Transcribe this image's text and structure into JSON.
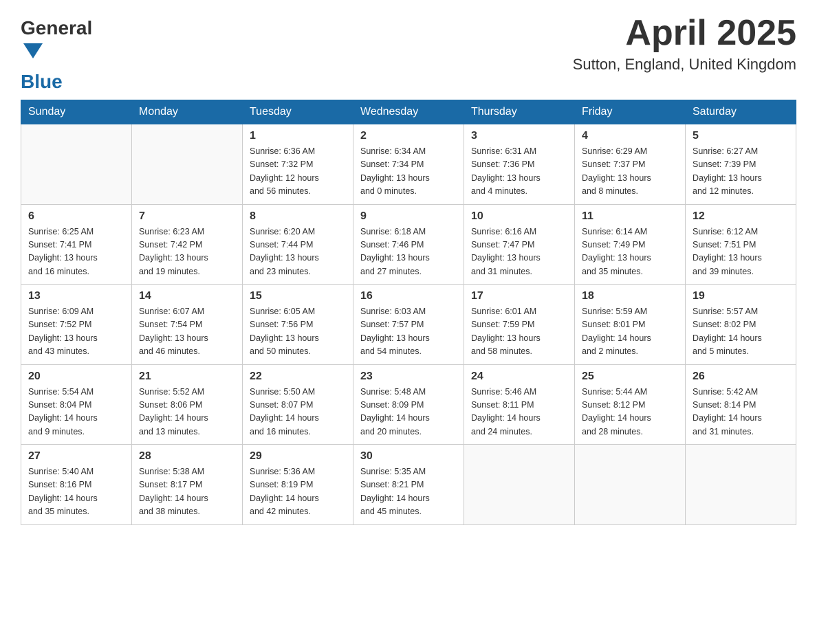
{
  "header": {
    "logo_general": "General",
    "logo_blue": "Blue",
    "title": "April 2025",
    "subtitle": "Sutton, England, United Kingdom"
  },
  "days_of_week": [
    "Sunday",
    "Monday",
    "Tuesday",
    "Wednesday",
    "Thursday",
    "Friday",
    "Saturday"
  ],
  "weeks": [
    [
      {
        "day": "",
        "info": ""
      },
      {
        "day": "",
        "info": ""
      },
      {
        "day": "1",
        "info": "Sunrise: 6:36 AM\nSunset: 7:32 PM\nDaylight: 12 hours\nand 56 minutes."
      },
      {
        "day": "2",
        "info": "Sunrise: 6:34 AM\nSunset: 7:34 PM\nDaylight: 13 hours\nand 0 minutes."
      },
      {
        "day": "3",
        "info": "Sunrise: 6:31 AM\nSunset: 7:36 PM\nDaylight: 13 hours\nand 4 minutes."
      },
      {
        "day": "4",
        "info": "Sunrise: 6:29 AM\nSunset: 7:37 PM\nDaylight: 13 hours\nand 8 minutes."
      },
      {
        "day": "5",
        "info": "Sunrise: 6:27 AM\nSunset: 7:39 PM\nDaylight: 13 hours\nand 12 minutes."
      }
    ],
    [
      {
        "day": "6",
        "info": "Sunrise: 6:25 AM\nSunset: 7:41 PM\nDaylight: 13 hours\nand 16 minutes."
      },
      {
        "day": "7",
        "info": "Sunrise: 6:23 AM\nSunset: 7:42 PM\nDaylight: 13 hours\nand 19 minutes."
      },
      {
        "day": "8",
        "info": "Sunrise: 6:20 AM\nSunset: 7:44 PM\nDaylight: 13 hours\nand 23 minutes."
      },
      {
        "day": "9",
        "info": "Sunrise: 6:18 AM\nSunset: 7:46 PM\nDaylight: 13 hours\nand 27 minutes."
      },
      {
        "day": "10",
        "info": "Sunrise: 6:16 AM\nSunset: 7:47 PM\nDaylight: 13 hours\nand 31 minutes."
      },
      {
        "day": "11",
        "info": "Sunrise: 6:14 AM\nSunset: 7:49 PM\nDaylight: 13 hours\nand 35 minutes."
      },
      {
        "day": "12",
        "info": "Sunrise: 6:12 AM\nSunset: 7:51 PM\nDaylight: 13 hours\nand 39 minutes."
      }
    ],
    [
      {
        "day": "13",
        "info": "Sunrise: 6:09 AM\nSunset: 7:52 PM\nDaylight: 13 hours\nand 43 minutes."
      },
      {
        "day": "14",
        "info": "Sunrise: 6:07 AM\nSunset: 7:54 PM\nDaylight: 13 hours\nand 46 minutes."
      },
      {
        "day": "15",
        "info": "Sunrise: 6:05 AM\nSunset: 7:56 PM\nDaylight: 13 hours\nand 50 minutes."
      },
      {
        "day": "16",
        "info": "Sunrise: 6:03 AM\nSunset: 7:57 PM\nDaylight: 13 hours\nand 54 minutes."
      },
      {
        "day": "17",
        "info": "Sunrise: 6:01 AM\nSunset: 7:59 PM\nDaylight: 13 hours\nand 58 minutes."
      },
      {
        "day": "18",
        "info": "Sunrise: 5:59 AM\nSunset: 8:01 PM\nDaylight: 14 hours\nand 2 minutes."
      },
      {
        "day": "19",
        "info": "Sunrise: 5:57 AM\nSunset: 8:02 PM\nDaylight: 14 hours\nand 5 minutes."
      }
    ],
    [
      {
        "day": "20",
        "info": "Sunrise: 5:54 AM\nSunset: 8:04 PM\nDaylight: 14 hours\nand 9 minutes."
      },
      {
        "day": "21",
        "info": "Sunrise: 5:52 AM\nSunset: 8:06 PM\nDaylight: 14 hours\nand 13 minutes."
      },
      {
        "day": "22",
        "info": "Sunrise: 5:50 AM\nSunset: 8:07 PM\nDaylight: 14 hours\nand 16 minutes."
      },
      {
        "day": "23",
        "info": "Sunrise: 5:48 AM\nSunset: 8:09 PM\nDaylight: 14 hours\nand 20 minutes."
      },
      {
        "day": "24",
        "info": "Sunrise: 5:46 AM\nSunset: 8:11 PM\nDaylight: 14 hours\nand 24 minutes."
      },
      {
        "day": "25",
        "info": "Sunrise: 5:44 AM\nSunset: 8:12 PM\nDaylight: 14 hours\nand 28 minutes."
      },
      {
        "day": "26",
        "info": "Sunrise: 5:42 AM\nSunset: 8:14 PM\nDaylight: 14 hours\nand 31 minutes."
      }
    ],
    [
      {
        "day": "27",
        "info": "Sunrise: 5:40 AM\nSunset: 8:16 PM\nDaylight: 14 hours\nand 35 minutes."
      },
      {
        "day": "28",
        "info": "Sunrise: 5:38 AM\nSunset: 8:17 PM\nDaylight: 14 hours\nand 38 minutes."
      },
      {
        "day": "29",
        "info": "Sunrise: 5:36 AM\nSunset: 8:19 PM\nDaylight: 14 hours\nand 42 minutes."
      },
      {
        "day": "30",
        "info": "Sunrise: 5:35 AM\nSunset: 8:21 PM\nDaylight: 14 hours\nand 45 minutes."
      },
      {
        "day": "",
        "info": ""
      },
      {
        "day": "",
        "info": ""
      },
      {
        "day": "",
        "info": ""
      }
    ]
  ]
}
